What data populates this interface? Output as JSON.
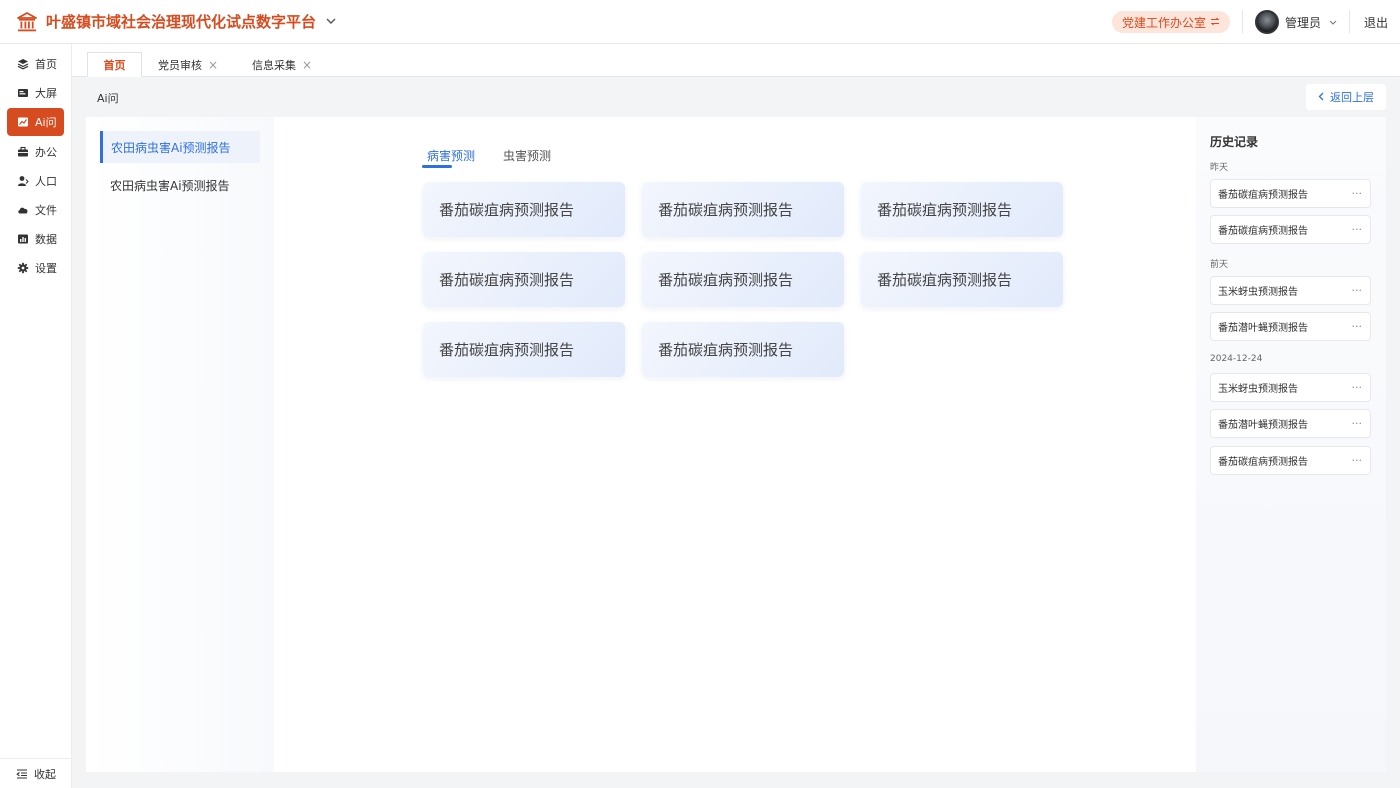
{
  "header": {
    "title": "叶盛镇市域社会治理现代化试点数字平台",
    "org_chip": "党建工作办公室",
    "user_name": "管理员",
    "logout": "退出",
    "brand_color": "#d64b1f"
  },
  "sidebar": {
    "items": [
      {
        "label": "首页",
        "icon": "layers-icon"
      },
      {
        "label": "大屏",
        "icon": "screen-icon"
      },
      {
        "label": "Ai问",
        "icon": "chart-icon",
        "active": true
      },
      {
        "label": "办公",
        "icon": "briefcase-icon"
      },
      {
        "label": "人口",
        "icon": "person-icon"
      },
      {
        "label": "文件",
        "icon": "cloud-icon"
      },
      {
        "label": "数据",
        "icon": "bar-chart-icon"
      },
      {
        "label": "设置",
        "icon": "gear-icon"
      }
    ],
    "collapse": "收起"
  },
  "tabs": [
    {
      "label": "首页",
      "active": true
    },
    {
      "label": "党员审核",
      "closable": true
    },
    {
      "label": "信息采集",
      "closable": true
    }
  ],
  "breadcrumb": "Ai问",
  "back_button": "返回上层",
  "left_tree": [
    {
      "label": "农田病虫害Ai预测报告",
      "active": true
    },
    {
      "label": "农田病虫害Ai预测报告"
    }
  ],
  "sub_tabs": [
    {
      "label": "病害预测",
      "active": true
    },
    {
      "label": "虫害预测"
    }
  ],
  "cards": [
    "番茄碳疽病预测报告",
    "番茄碳疽病预测报告",
    "番茄碳疽病预测报告",
    "番茄碳疽病预测报告",
    "番茄碳疽病预测报告",
    "番茄碳疽病预测报告",
    "番茄碳疽病预测报告",
    "番茄碳疽病预测报告"
  ],
  "history": {
    "title": "历史记录",
    "groups": [
      {
        "label": "昨天",
        "items": [
          "番茄碳疽病预测报告",
          "番茄碳疽病预测报告"
        ]
      },
      {
        "label": "前天",
        "items": [
          "玉米蚜虫预测报告",
          "番茄潜叶蝇预测报告"
        ]
      },
      {
        "label": "2024-12-24",
        "items": [
          "玉米蚜虫预测报告",
          "番茄潜叶蝇预测报告",
          "番茄碳疽病预测报告"
        ]
      }
    ],
    "more": "···"
  },
  "accent_color": "#2f6fde"
}
